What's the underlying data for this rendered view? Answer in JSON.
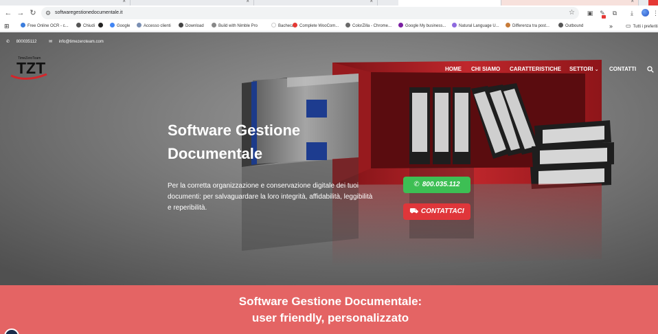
{
  "browser": {
    "url": "softwaregestionedocumentale.it",
    "bookmarks": [
      {
        "label": "Free Online OCR - c...",
        "color": "#3b7ddd"
      },
      {
        "label": "Chiudi",
        "color": "#555555"
      },
      {
        "label": "",
        "color": "#222222"
      },
      {
        "label": "Google",
        "color": "#4285f4"
      },
      {
        "label": "Accesso clienti",
        "color": "#7a8fb3"
      },
      {
        "label": "Download",
        "color": "#444444"
      },
      {
        "label": "Build with Nimble Pro",
        "color": "#888888"
      },
      {
        "label": "Bacheca",
        "color": "#ffffff"
      },
      {
        "label": "Complete WooCom...",
        "color": "#e53935"
      },
      {
        "label": "ColorZilla - Chrome...",
        "color": "#6a6a6a"
      },
      {
        "label": "Google My business...",
        "color": "#7b1fa2"
      },
      {
        "label": "Natural Language U...",
        "color": "#8e6adf"
      },
      {
        "label": "Differenza tra post...",
        "color": "#c77c3a"
      },
      {
        "label": "Outbound",
        "color": "#555555"
      }
    ],
    "bookmarks_more": "»",
    "bookmarks_folder": "Tutti i preferiti"
  },
  "site": {
    "topbar": {
      "phone": "800035112",
      "email": "info@timezeroteam.com"
    },
    "logo": {
      "text": "TimeZeroTeam",
      "monogram": "TZT"
    },
    "nav": [
      {
        "label": "HOME"
      },
      {
        "label": "CHI SIAMO"
      },
      {
        "label": "CARATTERISTICHE"
      },
      {
        "label": "SETTORI"
      },
      {
        "label": "CONTATTI"
      }
    ],
    "hero": {
      "title": "Software Gestione Documentale",
      "description": "Per la corretta organizzazione e conservazione digitale dei tuoi documenti: per salvaguardare la loro integrità, affidabilità, leggibilità e reperibilità.",
      "phone_button": "800.035.112",
      "contact_button": "CONTATTACI"
    },
    "band": {
      "title_line1": "Software Gestione Documentale:",
      "title_line2": "user friendly, personalizzato"
    }
  },
  "colors": {
    "green_button": "#3dbf54",
    "red_button": "#e0363a",
    "band": "#e46464",
    "cabinet": "#b51f24"
  }
}
